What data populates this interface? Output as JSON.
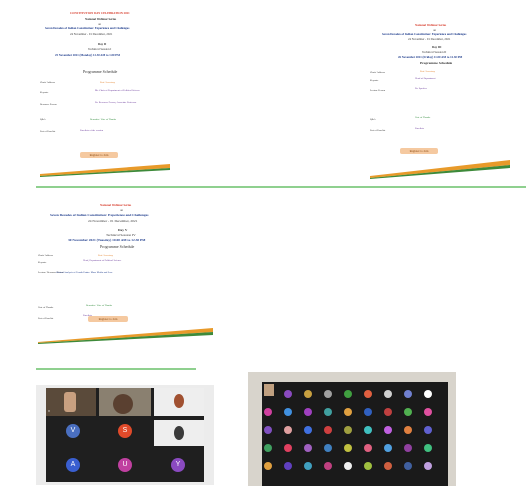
{
  "panel1": {
    "line1": "CONSTITUTION DAY CELEBRATION 2021",
    "line2": "National Webinar Series",
    "line3": "on",
    "line4": "Seven Decades of Indian Constitution: Experience and Challenges",
    "line5": "24 November - 01 December, 2021",
    "day": "Day II",
    "session": "Technical Session I",
    "datetime": "25 November 2021 (Monday) 12.30 AM to 1.00 PM",
    "schedule": "Programme Schedule",
    "rows": [
      {
        "label": "Chair/ Address",
        "value": "Prof. Secretary"
      },
      {
        "label": "Keynote",
        "value": "Mr. Chair of Department of Political Science"
      },
      {
        "label": "Resource Person",
        "value": "Dr. Resource Person, Associate Professor"
      },
      {
        "label": "Q&A",
        "value": "Remarks / Vote of Thanks"
      },
      {
        "label": "List of Panelist",
        "value": "Panelists of the session"
      }
    ],
    "button": "Register to Join"
  },
  "panel2": {
    "line1": "National Webinar Series",
    "line2": "on",
    "line3": "Seven Decades of Indian Constitution: Experience and Challenges",
    "line4": "24 November - 01 December, 2021",
    "day": "Day III",
    "session": "Technical Session II",
    "datetime": "26 November 2021 (Friday) 11.00 AM to 12.30 PM",
    "schedule": "Programme Schedule",
    "rows": [
      {
        "label": "Chair/ Address",
        "value": "Prof. Secretary"
      },
      {
        "label": "Keynote",
        "value": "Head of Department"
      },
      {
        "label": "Lecture Person",
        "value": "Dr. Speaker"
      },
      {
        "label": "Q&A",
        "value": "Vote of Thanks"
      },
      {
        "label": "List of Panelist",
        "value": "Panelists"
      }
    ],
    "button": "Register to Join"
  },
  "panel3": {
    "line1": "National Webinar Series",
    "line2": "on",
    "line3": "Seven Decades of Indian Constitution: Experience and Challenges",
    "line4": "24 November - 01 December, 2021",
    "day": "Day V",
    "session": "Technical Session IV",
    "datetime": "30 November 2021 (Tuesday) 10.00 AM to 12.30 PM",
    "schedule": "Programme Schedule",
    "rows": [
      {
        "label": "Chair/ Address",
        "value": "Prof. Secretary"
      },
      {
        "label": "Keynote",
        "value": "Head, Department of Political Science"
      },
      {
        "label": "Lecture/ Resource Person",
        "value": "Critical Analysis of Fourth Estate: Mass Media and Law"
      },
      {
        "label": "Vote of Thanks",
        "value": "Remarks / Vote of Thanks"
      },
      {
        "label": "List of Panelist",
        "value": "Panelists"
      }
    ],
    "button": "Register to Join"
  },
  "meeting1": {
    "name_label": "V",
    "avatars": [
      "V",
      "S",
      "A",
      "U",
      "Y"
    ],
    "avatar_colors": [
      "#4a6fc0",
      "#e04a2a",
      "#3a5fd0",
      "#c040a0",
      "#8a4ac0"
    ]
  }
}
